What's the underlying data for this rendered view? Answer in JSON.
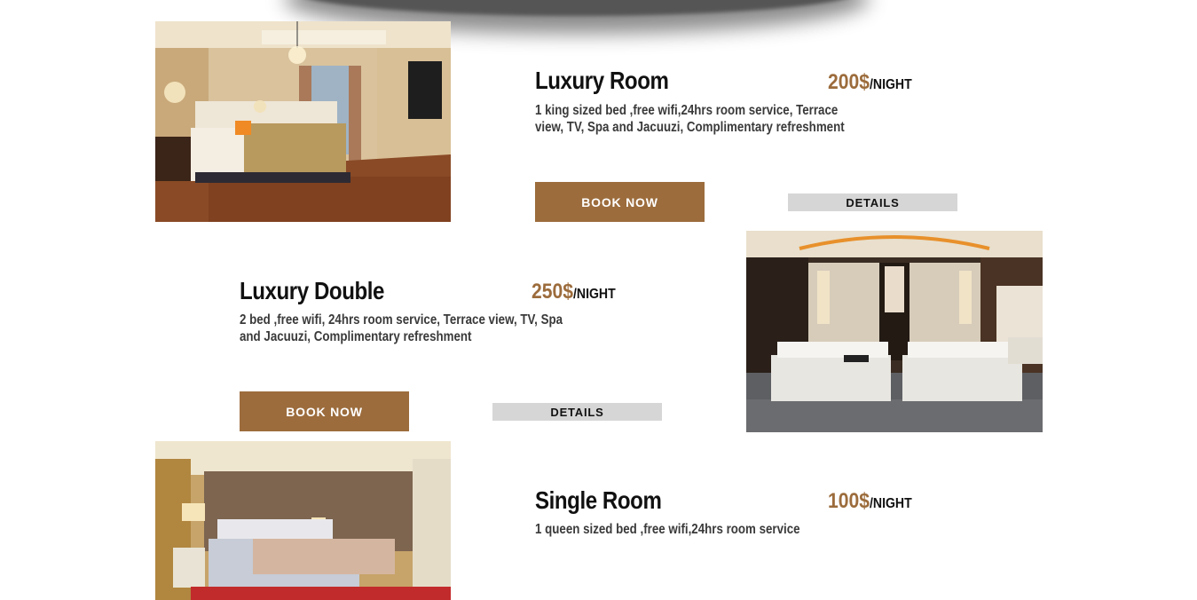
{
  "colors": {
    "accent": "#9c6c3c",
    "details_bg": "#d6d6d6",
    "text": "#111111"
  },
  "rooms": [
    {
      "title": "Luxury Room",
      "price": "200$",
      "price_unit": "/NIGHT",
      "desc_line1": "1 king sized bed ,free wifi,24hrs room service, Terrace",
      "desc_line2": "view, TV, Spa and Jacuuzi, Complimentary refreshment",
      "book_label": "BOOK NOW",
      "details_label": "DETAILS",
      "image_icon": "bedroom-photo"
    },
    {
      "title": "Luxury Double",
      "price": "250$",
      "price_unit": "/NIGHT",
      "desc_line1": "2 bed ,free wifi, 24hrs room service, Terrace view, TV, Spa",
      "desc_line2": "and Jacuuzi, Complimentary refreshment",
      "book_label": "BOOK NOW",
      "details_label": "DETAILS",
      "image_icon": "twin-bed-photo"
    },
    {
      "title": "Single Room",
      "price": "100$",
      "price_unit": "/NIGHT",
      "desc_line1": "1 queen sized bed ,free wifi,24hrs room service",
      "image_icon": "single-room-photo"
    }
  ]
}
